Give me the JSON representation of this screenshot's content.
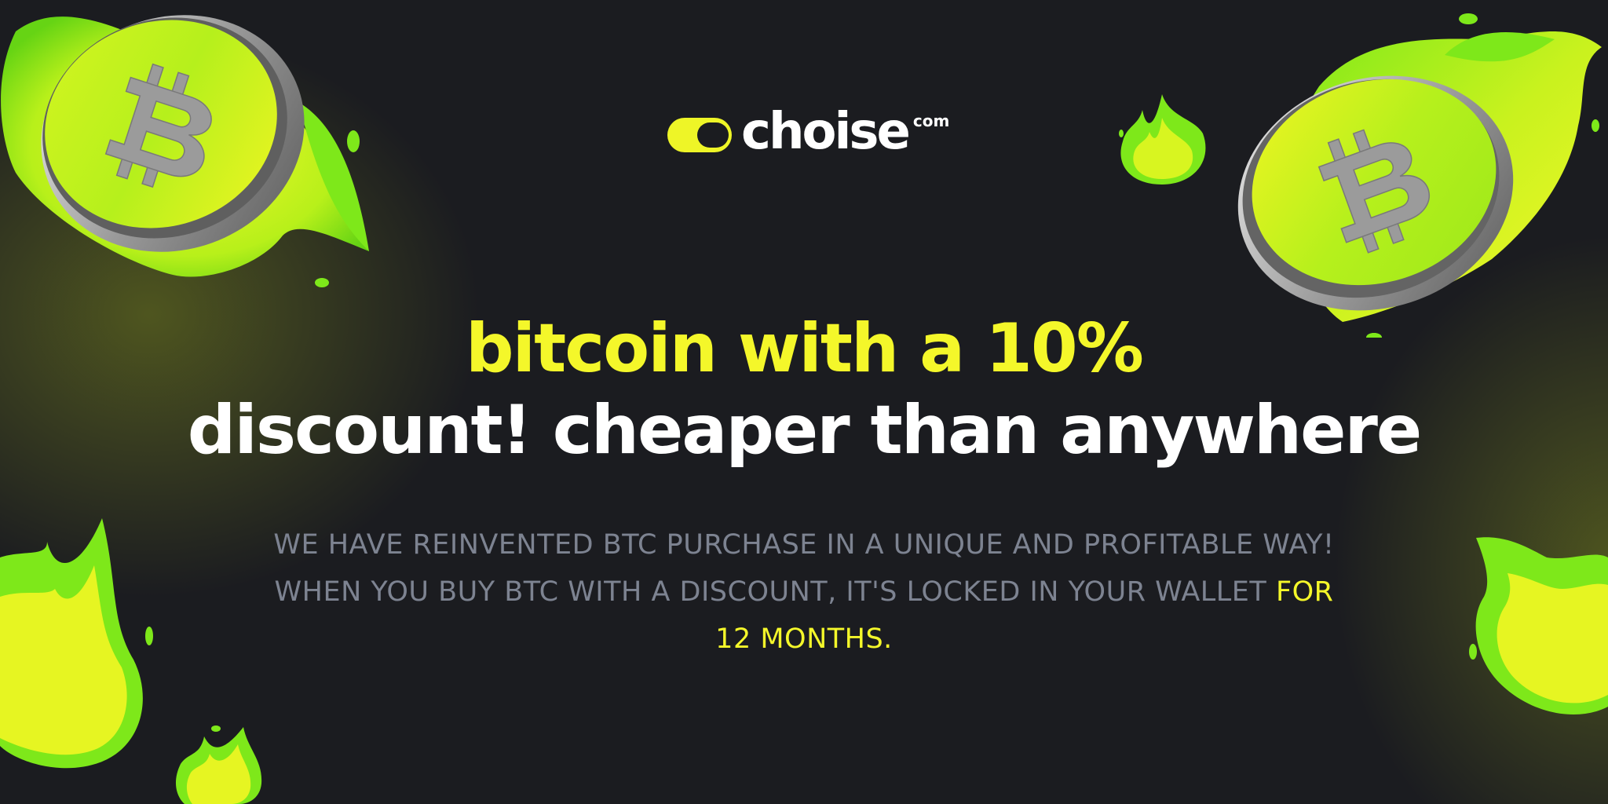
{
  "brand": {
    "name": "choise",
    "tld": "com"
  },
  "headline": {
    "line1": "bitcoin with a 10%",
    "line2": "discount! cheaper than anywhere"
  },
  "description": {
    "text": "WE HAVE REINVENTED BTC PURCHASE IN A UNIQUE AND PROFITABLE WAY! WHEN YOU BUY BTC WITH A DISCOUNT, IT'S LOCKED IN YOUR WALLET",
    "highlight": "FOR 12 MONTHS."
  },
  "decorations": {
    "coins": [
      "bitcoin-coin-icon",
      "bitcoin-coin-icon"
    ],
    "flames": [
      "flame-icon",
      "flame-icon",
      "flame-icon",
      "flame-icon"
    ]
  },
  "colors": {
    "background": "#1b1c20",
    "accent": "#f4f72a",
    "flame_green": "#7ee81a",
    "text_white": "#ffffff",
    "text_muted": "#7d8391",
    "coin_silver": "#a9a9a9"
  }
}
